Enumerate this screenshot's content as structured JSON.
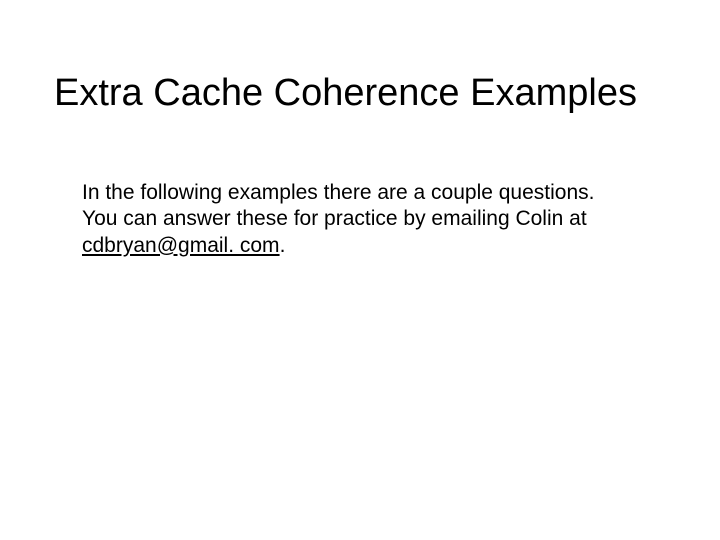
{
  "title": "Extra Cache Coherence Examples",
  "body_before": "In the following examples there are a couple questions. You can answer these for practice by emailing Colin at ",
  "email": "cdbryan@gmail. com",
  "body_after": "."
}
